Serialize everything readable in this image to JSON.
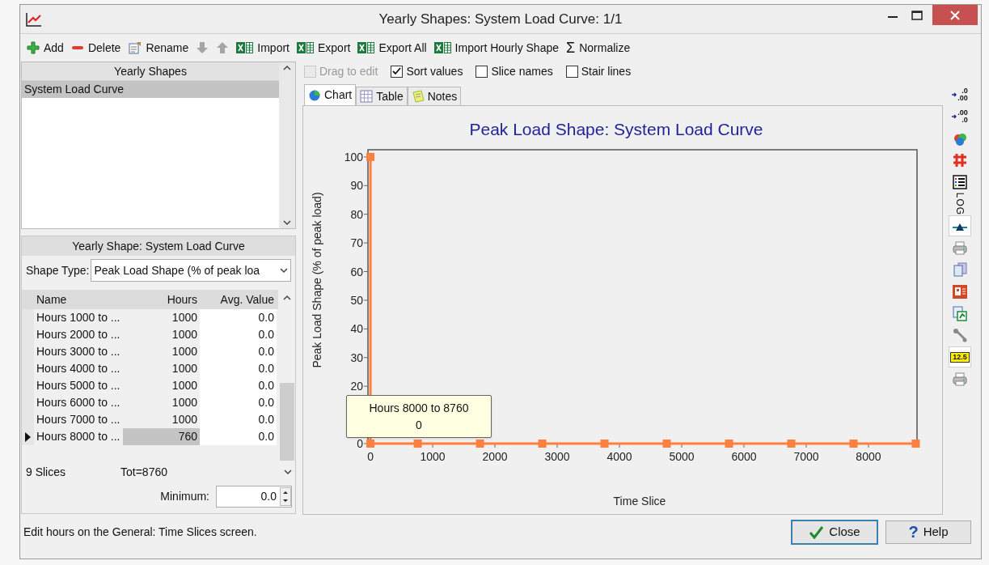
{
  "window": {
    "title": "Yearly Shapes: System Load Curve: 1/1"
  },
  "toolbar": [
    {
      "label": "Add",
      "kind": "plus",
      "disabled": false
    },
    {
      "label": "Delete",
      "kind": "minus",
      "disabled": false
    },
    {
      "label": "Rename",
      "kind": "rename",
      "disabled": false
    },
    {
      "kind": "arrow_down",
      "disabled": true
    },
    {
      "kind": "arrow_up",
      "disabled": true
    },
    {
      "label": "Import",
      "kind": "excel",
      "disabled": false
    },
    {
      "label": "Export",
      "kind": "excel",
      "disabled": false
    },
    {
      "label": "Export All",
      "kind": "excel",
      "disabled": false
    },
    {
      "label": "Import Hourly Shape",
      "kind": "excel",
      "disabled": false
    },
    {
      "label": "Normalize",
      "kind": "sigma",
      "glyph": "Σ",
      "disabled": false
    }
  ],
  "shapes_list": {
    "header": "Yearly Shapes",
    "items": [
      {
        "label": "System Load Curve",
        "selected": true
      }
    ]
  },
  "shape_panel": {
    "header": "Yearly Shape: System Load Curve",
    "shape_type_label": "Shape Type:",
    "shape_type_value": "Peak Load Shape (% of peak loa",
    "columns": [
      "Name",
      "Hours",
      "Avg. Value"
    ],
    "rows": [
      {
        "name": "Hours 1000 to ...",
        "hours": "1000",
        "avg": "0.0",
        "selected": false
      },
      {
        "name": "Hours 2000 to ...",
        "hours": "1000",
        "avg": "0.0",
        "selected": false
      },
      {
        "name": "Hours 3000 to ...",
        "hours": "1000",
        "avg": "0.0",
        "selected": false
      },
      {
        "name": "Hours 4000 to ...",
        "hours": "1000",
        "avg": "0.0",
        "selected": false
      },
      {
        "name": "Hours 5000 to ...",
        "hours": "1000",
        "avg": "0.0",
        "selected": false
      },
      {
        "name": "Hours 6000 to ...",
        "hours": "1000",
        "avg": "0.0",
        "selected": false
      },
      {
        "name": "Hours 7000 to ...",
        "hours": "1000",
        "avg": "0.0",
        "selected": false
      },
      {
        "name": "Hours 8000 to ...",
        "hours": "760",
        "avg": "0.0",
        "selected": true
      }
    ],
    "slices": "9 Slices",
    "total": "Tot=8760",
    "minimum_label": "Minimum:",
    "minimum_value": "0.0"
  },
  "options": [
    {
      "label": "Drag to edit",
      "checked": false,
      "disabled": true
    },
    {
      "label": "Sort values",
      "checked": true,
      "disabled": false
    },
    {
      "label": "Slice names",
      "checked": false,
      "disabled": false
    },
    {
      "label": "Stair lines",
      "checked": false,
      "disabled": false
    }
  ],
  "tabs": [
    {
      "label": "Chart",
      "kind": "chart",
      "selected": true
    },
    {
      "label": "Table",
      "kind": "table",
      "selected": false
    },
    {
      "label": "Notes",
      "kind": "notes",
      "selected": false
    }
  ],
  "chart": {
    "chart_data": {
      "type": "line",
      "title": "Peak Load Shape: System Load Curve",
      "xlabel": "Time Slice",
      "ylabel": "Peak Load Shape (% of peak load)",
      "x": [
        0,
        0,
        760,
        1760,
        2760,
        3760,
        4760,
        5760,
        6760,
        7760,
        8760
      ],
      "series": [
        {
          "color": "#ff7f3f",
          "marker": "square",
          "values": [
            100,
            0,
            0,
            0,
            0,
            0,
            0,
            0,
            0,
            0,
            0
          ]
        }
      ],
      "xlim": [
        -40,
        8780
      ],
      "ylim": [
        0,
        102.5
      ],
      "xticks": [
        0,
        1000,
        2000,
        3000,
        4000,
        5000,
        6000,
        7000,
        8000
      ],
      "yticks": [
        0,
        20,
        30,
        40,
        50,
        60,
        70,
        80,
        90,
        100
      ]
    },
    "tooltip": {
      "title": "Hours 8000 to 8760",
      "value": "0"
    }
  },
  "side_tools": [
    {
      "kind": "decimals_add",
      "text_top": ".0",
      "text_bottom": ".00",
      "pressed": false
    },
    {
      "kind": "decimals_remove",
      "text_top": ".00",
      "text_bottom": ".0",
      "pressed": false
    },
    {
      "kind": "colors",
      "pressed": false
    },
    {
      "kind": "grid",
      "pressed": false
    },
    {
      "kind": "legend",
      "pressed": false
    },
    {
      "kind": "log",
      "text": "LOG",
      "pressed": false
    },
    {
      "kind": "balance",
      "pressed": true
    },
    {
      "kind": "print",
      "pressed": false
    },
    {
      "kind": "copy",
      "pressed": false
    },
    {
      "kind": "powerpoint",
      "pressed": false
    },
    {
      "kind": "export_image",
      "pressed": false
    },
    {
      "kind": "wrench",
      "pressed": false
    },
    {
      "kind": "value_labels",
      "text": "12.5",
      "pressed": true
    },
    {
      "kind": "print",
      "pressed": false
    }
  ],
  "status_bar": "Edit hours on the General: Time Slices screen.",
  "buttons": [
    {
      "label": "Close",
      "kind": "check",
      "default": true
    },
    {
      "label": "Help",
      "kind": "question",
      "glyph": "?",
      "default": false
    }
  ]
}
